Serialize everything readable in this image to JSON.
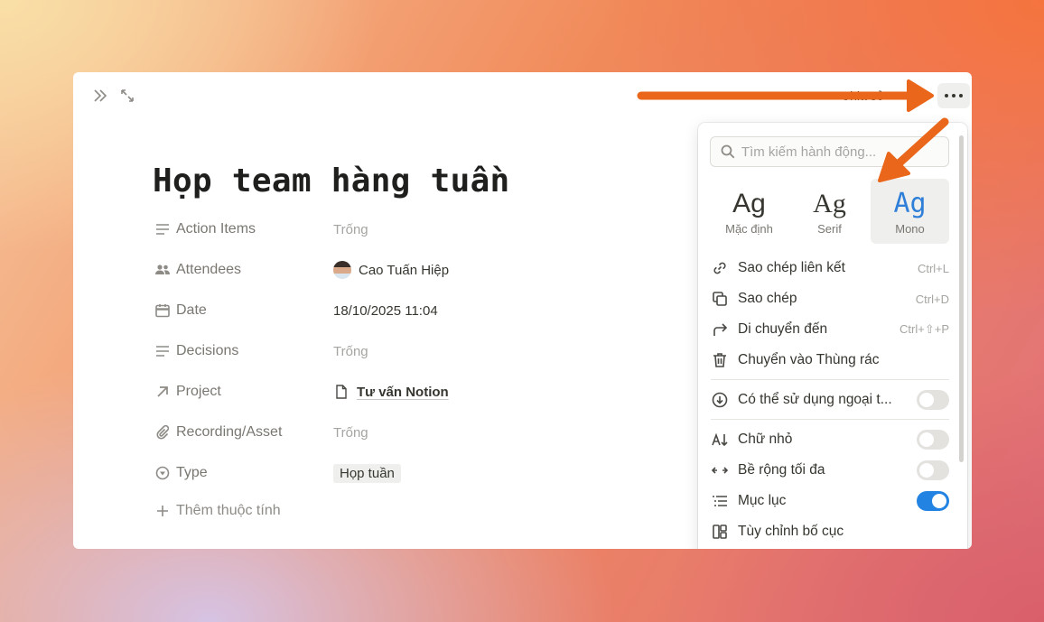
{
  "topbar": {
    "share_label": "Chia sẻ"
  },
  "page": {
    "title": "Họp team hàng tuần",
    "properties": [
      {
        "key": "Action Items",
        "value": "Trống"
      },
      {
        "key": "Attendees",
        "value": "Cao Tuấn Hiệp"
      },
      {
        "key": "Date",
        "value": "18/10/2025 11:04"
      },
      {
        "key": "Decisions",
        "value": "Trống"
      },
      {
        "key": "Project",
        "value": "Tư vấn Notion"
      },
      {
        "key": "Recording/Asset",
        "value": "Trống"
      },
      {
        "key": "Type",
        "value": "Họp tuần"
      }
    ],
    "add_property": "Thêm thuộc tính"
  },
  "menu": {
    "search_placeholder": "Tìm kiếm hành động...",
    "fonts": [
      {
        "sample": "Ag",
        "label": "Mặc định"
      },
      {
        "sample": "Ag",
        "label": "Serif"
      },
      {
        "sample": "Ag",
        "label": "Mono"
      }
    ],
    "selected_font": "Mono",
    "items": [
      {
        "label": "Sao chép liên kết",
        "shortcut": "Ctrl+L",
        "icon": "link-icon"
      },
      {
        "label": "Sao chép",
        "shortcut": "Ctrl+D",
        "icon": "duplicate-icon"
      },
      {
        "label": "Di chuyển đến",
        "shortcut": "Ctrl+⇧+P",
        "icon": "move-icon"
      },
      {
        "label": "Chuyển vào Thùng rác",
        "shortcut": "",
        "icon": "trash-icon"
      }
    ],
    "offline": {
      "label": "Có thể sử dụng ngoại t...",
      "on": false
    },
    "toggles": [
      {
        "label": "Chữ nhỏ",
        "on": false,
        "icon": "small-text-icon"
      },
      {
        "label": "Bề rộng tối đa",
        "on": false,
        "icon": "full-width-icon"
      },
      {
        "label": "Mục lục",
        "on": true,
        "icon": "table-of-contents-icon"
      }
    ],
    "customize_layout": "Tùy chỉnh bố cục"
  },
  "colors": {
    "accent": "#2383e2",
    "arrow": "#e9661a",
    "mono_sample": "#2f7fd8"
  }
}
